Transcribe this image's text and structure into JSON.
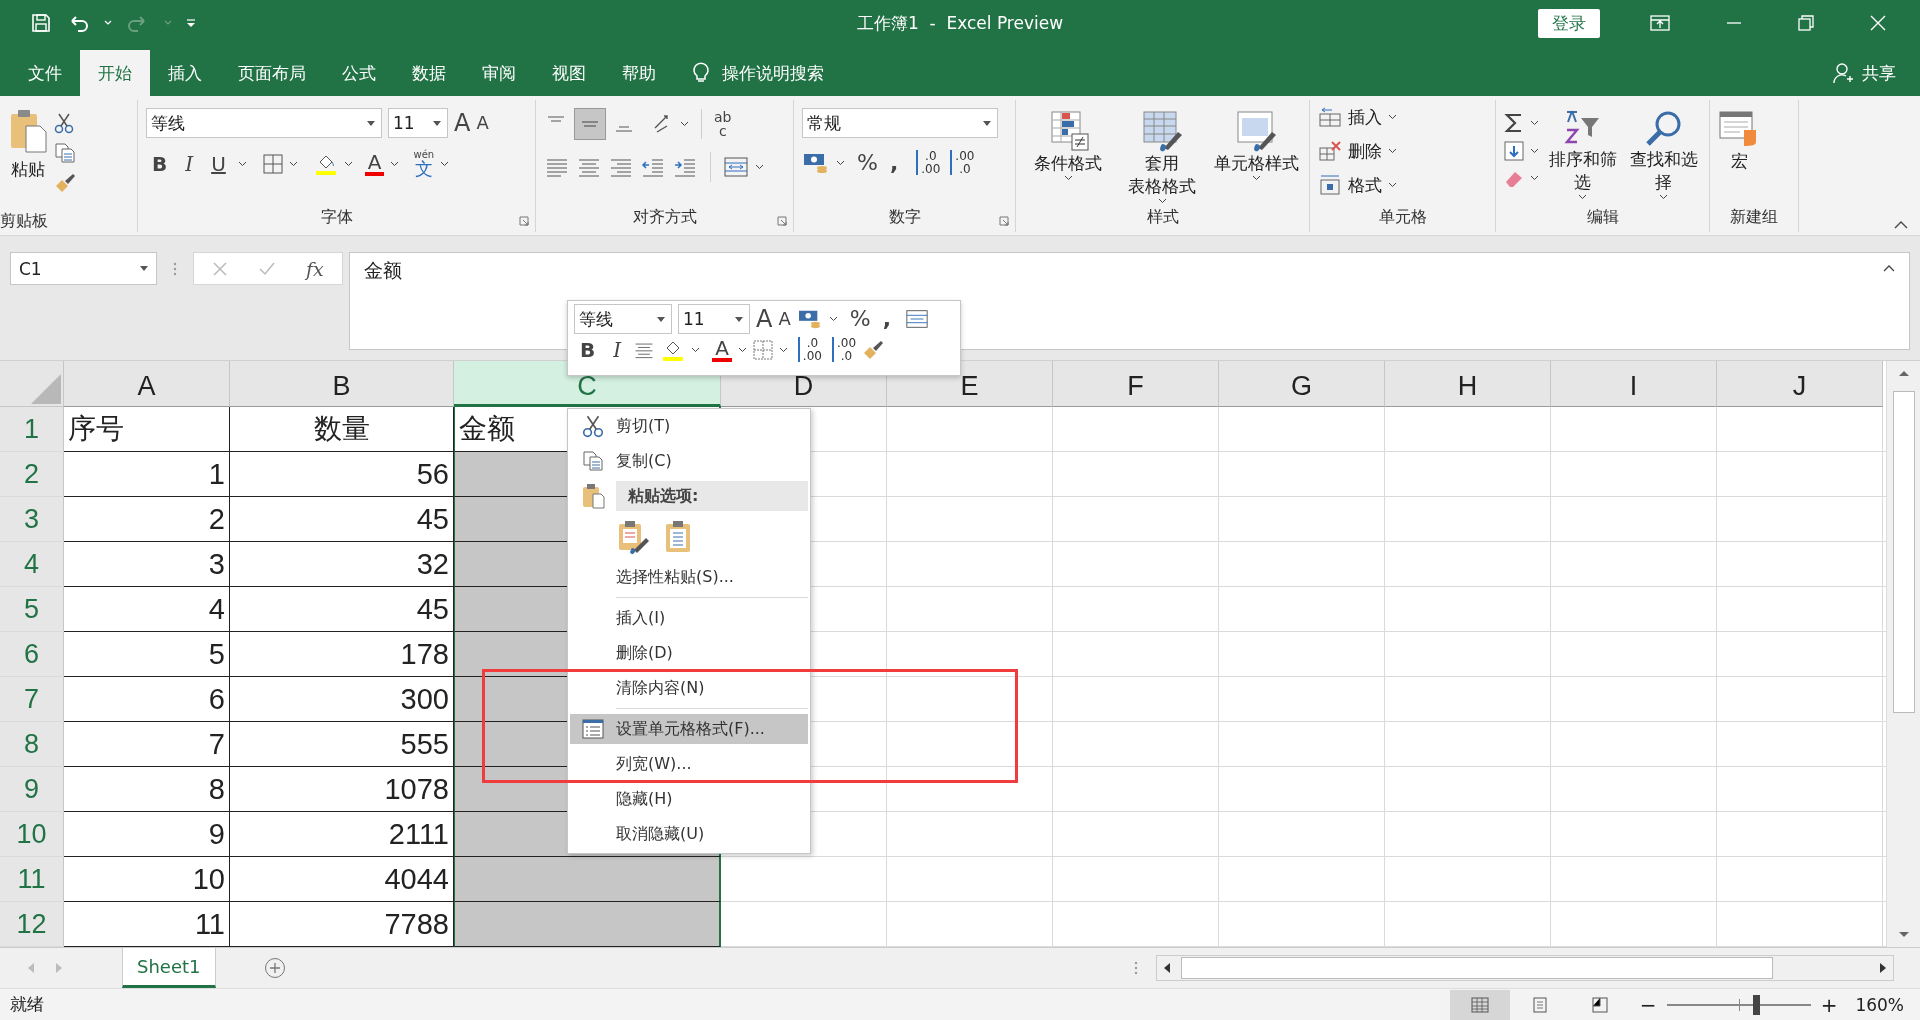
{
  "title_bar": {
    "title": "工作簿1  -  Excel Preview",
    "login": "登录"
  },
  "menu_tabs": [
    {
      "label": "文件",
      "selected": false
    },
    {
      "label": "开始",
      "selected": true
    },
    {
      "label": "插入",
      "selected": false
    },
    {
      "label": "页面布局",
      "selected": false
    },
    {
      "label": "公式",
      "selected": false
    },
    {
      "label": "数据",
      "selected": false
    },
    {
      "label": "审阅",
      "selected": false
    },
    {
      "label": "视图",
      "selected": false
    },
    {
      "label": "帮助",
      "selected": false
    }
  ],
  "tell_me": "操作说明搜索",
  "share": "共享",
  "ribbon": {
    "clipboard": {
      "paste": "粘贴",
      "label": "剪贴板"
    },
    "font": {
      "name": "等线",
      "size": "11",
      "grow": "A",
      "shrink": "A",
      "bold": "B",
      "italic": "I",
      "underline": "U",
      "font_color": "A",
      "phonetic_top": "wén",
      "phonetic": "文",
      "label": "字体"
    },
    "alignment": {
      "wrap_top": "ab",
      "wrap_bottom": "c",
      "label": "对齐方式"
    },
    "number": {
      "format": "常规",
      "percent": "%",
      "comma": ",",
      "inc_top": ".0",
      "inc_bottom": ".00",
      "dec_top": ".00",
      "dec_bottom": ".0",
      "label": "数字"
    },
    "styles": {
      "buttons": [
        {
          "lines": [
            "条件格式"
          ]
        },
        {
          "lines": [
            "套用",
            "表格格式"
          ]
        },
        {
          "lines": [
            "单元格样式"
          ]
        }
      ],
      "label": "样式"
    },
    "cells": {
      "buttons": [
        "插入",
        "删除",
        "格式"
      ],
      "label": "单元格"
    },
    "editing": {
      "buttons": [
        "排序和筛选",
        "查找和选择"
      ],
      "label": "编辑"
    },
    "new_group": {
      "button": "宏",
      "label": "新建组"
    }
  },
  "formula_bar": {
    "name_box": "C1",
    "fx": "fx",
    "formula": "金额"
  },
  "grid": {
    "columns": [
      {
        "label": "A",
        "selected": false
      },
      {
        "label": "B",
        "selected": false
      },
      {
        "label": "C",
        "selected": true
      },
      {
        "label": "D",
        "selected": false
      },
      {
        "label": "E",
        "selected": false
      },
      {
        "label": "F",
        "selected": false
      },
      {
        "label": "G",
        "selected": false
      },
      {
        "label": "H",
        "selected": false
      },
      {
        "label": "I",
        "selected": false
      },
      {
        "label": "J",
        "selected": false
      }
    ],
    "rows": [
      {
        "number": "1",
        "kind": "header",
        "cells": [
          "序号",
          "数量",
          "金额"
        ]
      },
      {
        "number": "2",
        "kind": "data",
        "cells": [
          "1",
          "56"
        ]
      },
      {
        "number": "3",
        "kind": "data",
        "cells": [
          "2",
          "45"
        ]
      },
      {
        "number": "4",
        "kind": "data",
        "cells": [
          "3",
          "32"
        ]
      },
      {
        "number": "5",
        "kind": "data",
        "cells": [
          "4",
          "45"
        ]
      },
      {
        "number": "6",
        "kind": "data",
        "cells": [
          "5",
          "178"
        ]
      },
      {
        "number": "7",
        "kind": "data",
        "cells": [
          "6",
          "300"
        ]
      },
      {
        "number": "8",
        "kind": "data",
        "cells": [
          "7",
          "555"
        ]
      },
      {
        "number": "9",
        "kind": "data",
        "cells": [
          "8",
          "1078"
        ]
      },
      {
        "number": "10",
        "kind": "data",
        "cells": [
          "9",
          "2111"
        ]
      },
      {
        "number": "11",
        "kind": "data",
        "cells": [
          "10",
          "4044"
        ]
      },
      {
        "number": "12",
        "kind": "data",
        "cells": [
          "11",
          "7788"
        ]
      }
    ]
  },
  "mini_toolbar": {
    "font": "等线",
    "size": "11",
    "grow": "A",
    "shrink": "A",
    "percent": "%",
    "comma": ",",
    "bold": "B",
    "italic": "I",
    "font_color": "A",
    "inc_top": ".0",
    "inc_bottom": ".00",
    "dec_top": ".00",
    "dec_bottom": ".0"
  },
  "context_menu": [
    {
      "kind": "cut",
      "label": "剪切(T)",
      "selected": false
    },
    {
      "kind": "copy",
      "label": "复制(C)",
      "selected": false
    },
    {
      "kind": "paste-header",
      "label": "粘贴选项:"
    },
    {
      "kind": "paste-icons"
    },
    {
      "kind": "plain",
      "label": "选择性粘贴(S)...",
      "selected": false
    },
    {
      "kind": "separator"
    },
    {
      "kind": "plain",
      "label": "插入(I)",
      "selected": false
    },
    {
      "kind": "plain",
      "label": "删除(D)",
      "selected": false
    },
    {
      "kind": "plain",
      "label": "清除内容(N)",
      "selected": false
    },
    {
      "kind": "separator"
    },
    {
      "kind": "format",
      "label": "设置单元格格式(F)...",
      "selected": true
    },
    {
      "kind": "plain",
      "label": "列宽(W)...",
      "selected": false
    },
    {
      "kind": "plain",
      "label": "隐藏(H)",
      "selected": false
    },
    {
      "kind": "plain",
      "label": "取消隐藏(U)",
      "selected": false
    }
  ],
  "annotation": {
    "kind": "rectangle"
  },
  "sheet_tabs": [
    {
      "label": "Sheet1",
      "selected": true
    }
  ],
  "status_bar": {
    "status": "就绪",
    "views": [
      {
        "kind": "normal",
        "selected": true
      },
      {
        "kind": "page-layout",
        "selected": false
      },
      {
        "kind": "page-break",
        "selected": false
      }
    ],
    "zoom": {
      "minus": "−",
      "plus": "+",
      "level": 0.62,
      "reading": "160%"
    }
  }
}
